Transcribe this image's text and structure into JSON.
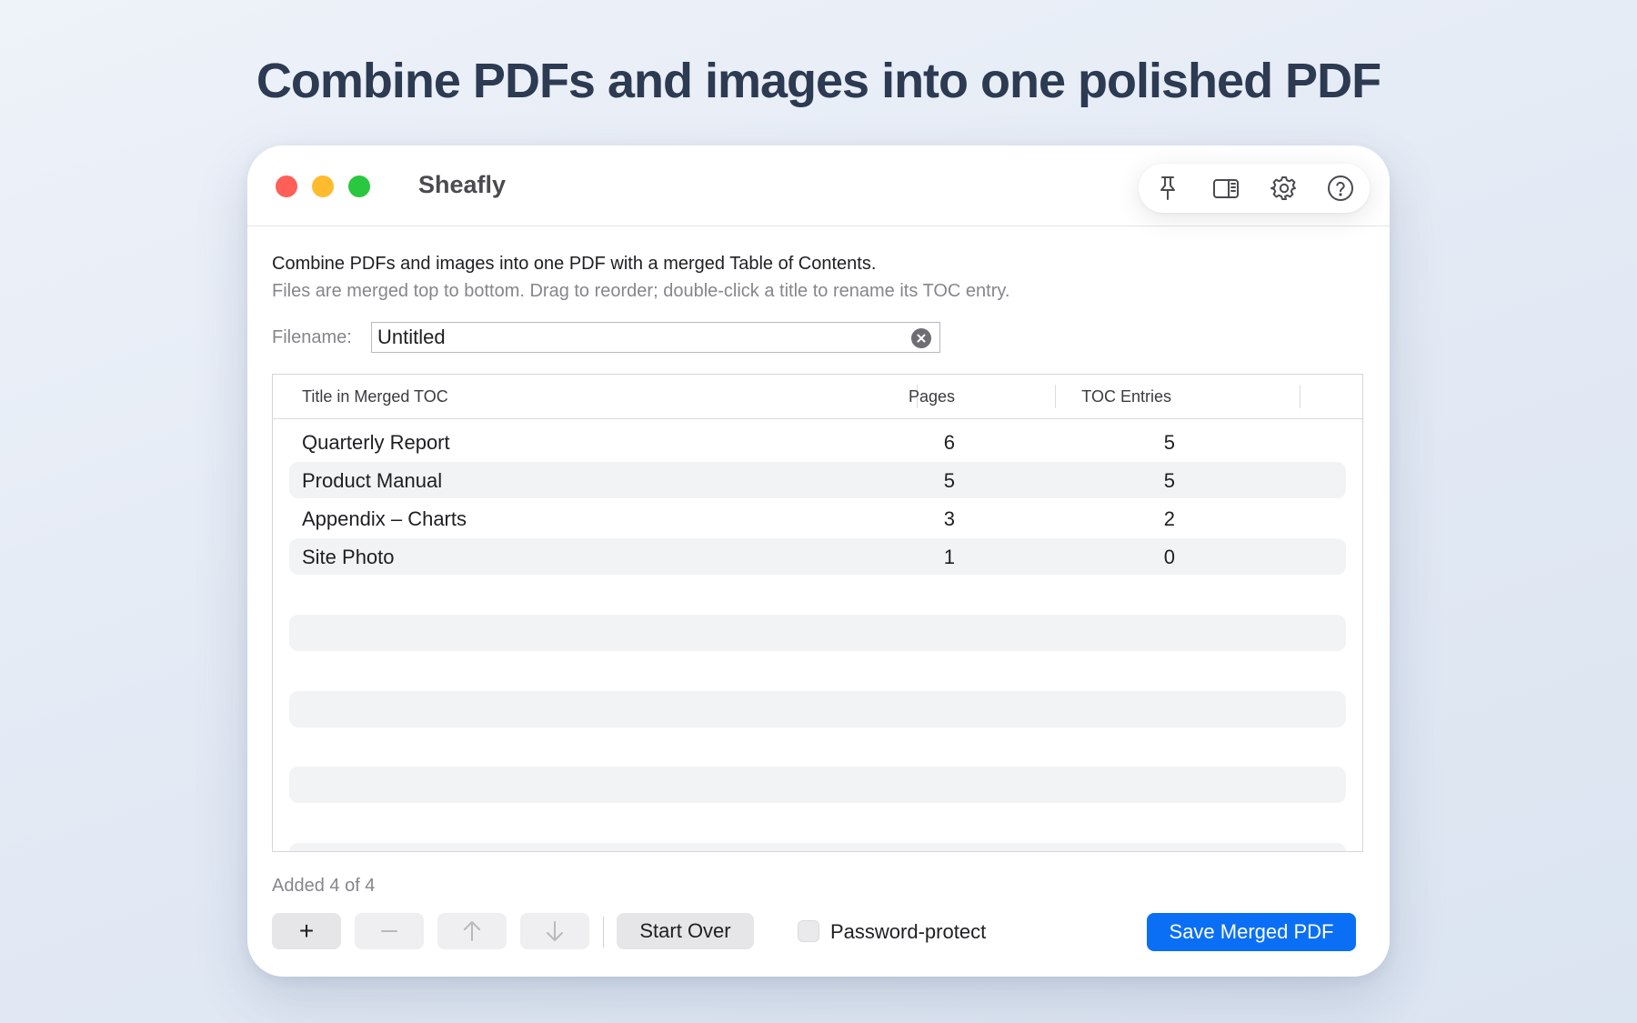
{
  "headline": "Combine PDFs and images into one polished PDF",
  "window": {
    "title": "Sheafly",
    "toolbar": {
      "icons": [
        "pin-icon",
        "sidebar-icon",
        "gear-icon",
        "help-icon"
      ]
    }
  },
  "intro": {
    "line1": "Combine PDFs and images into one PDF with a merged Table of Contents.",
    "line2": "Files are merged top to bottom. Drag to reorder; double-click a title to rename its TOC entry."
  },
  "filename": {
    "label": "Filename:",
    "value": "Untitled"
  },
  "table": {
    "columns": {
      "title": "Title in Merged TOC",
      "pages": "Pages",
      "toc": "TOC Entries"
    },
    "rows": [
      {
        "title": "Quarterly Report",
        "pages": "6",
        "toc": "5"
      },
      {
        "title": "Product Manual",
        "pages": "5",
        "toc": "5"
      },
      {
        "title": "Appendix – Charts",
        "pages": "3",
        "toc": "2"
      },
      {
        "title": "Site Photo",
        "pages": "1",
        "toc": "0"
      }
    ]
  },
  "status": "Added 4 of 4",
  "actions": {
    "add": "+",
    "start_over": "Start Over",
    "password_label": "Password-protect",
    "password_checked": false,
    "save": "Save Merged PDF"
  },
  "colors": {
    "accent": "#0b6ff5",
    "close": "#fe5f57",
    "minimize": "#febb2e",
    "zoom": "#29c840"
  }
}
